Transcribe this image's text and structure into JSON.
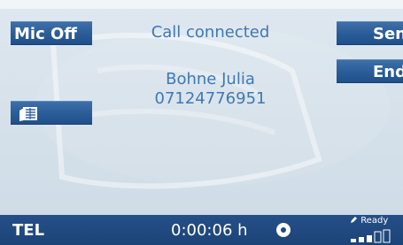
{
  "softkeys": {
    "mic_label": "Mic Off",
    "send_label": "Send",
    "end_label": "End",
    "phonebook_icon": "phonebook-icon"
  },
  "call": {
    "status": "Call connected",
    "contact_name": "Bohne Julia",
    "contact_number": "07124776951"
  },
  "status_bar": {
    "mode": "TEL",
    "duration": "0:00:06 h",
    "ready_label": "Ready",
    "signal_level": 0.5
  },
  "colors": {
    "softkey_blue": "#2a5c98",
    "text_blue": "#3f78b4",
    "status_bar_blue": "#1f4a80",
    "background": "#d6e1ea"
  },
  "icons": {
    "ready": "pencil-icon",
    "indicator": "circle-dot-icon",
    "signal": "signal-strength-icon"
  }
}
